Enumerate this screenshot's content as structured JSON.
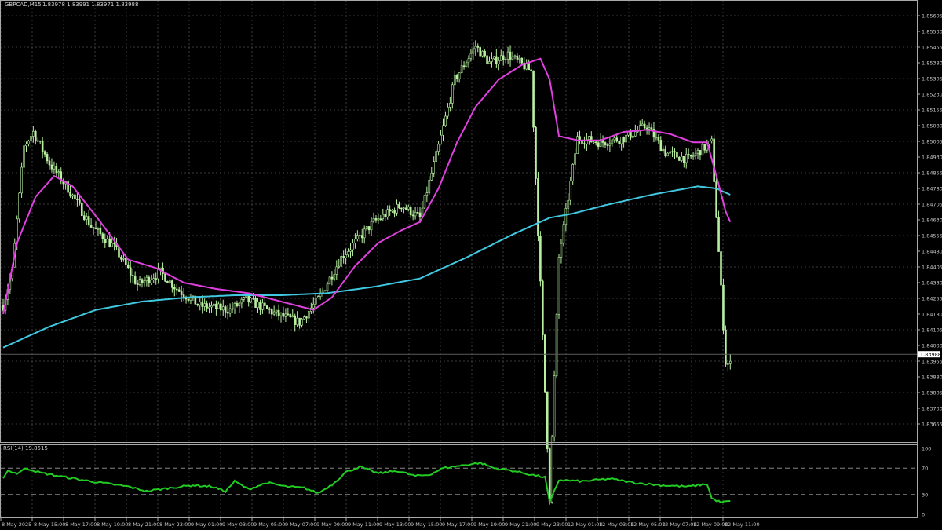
{
  "header": {
    "symbol": "GBPCAD,M15",
    "ohlc": "1.83978 1.83991 1.83971 1.83988"
  },
  "colors": {
    "background": "#000000",
    "grid": "#3a3a3a",
    "axis_text": "#c8c8c8",
    "candle": "#b8f0a0",
    "ma_fast": "#e040e0",
    "ma_slow": "#40c8e0",
    "rsi": "#22cc22",
    "price_tag_bg": "#ffffff",
    "price_tag_text": "#000000"
  },
  "chart_data": [
    {
      "type": "candlestick",
      "title": "GBPCAD,M15",
      "x_ticks": [
        "8 May 2025",
        "8 May 15:00",
        "8 May 17:00",
        "8 May 19:00",
        "8 May 21:00",
        "8 May 23:00",
        "9 May 01:00",
        "9 May 03:00",
        "9 May 05:00",
        "9 May 07:00",
        "9 May 09:00",
        "9 May 11:00",
        "9 May 13:00",
        "9 May 15:00",
        "9 May 17:00",
        "9 May 19:00",
        "9 May 21:00",
        "9 May 23:00",
        "12 May 01:00",
        "12 May 03:00",
        "12 May 05:00",
        "12 May 07:00",
        "12 May 09:00",
        "12 May 11:00"
      ],
      "y_ticks": [
        "1.85605",
        "1.85530",
        "1.85455",
        "1.85380",
        "1.85305",
        "1.85230",
        "1.85155",
        "1.85080",
        "1.85005",
        "1.84930",
        "1.84855",
        "1.84780",
        "1.84705",
        "1.84630",
        "1.84555",
        "1.84480",
        "1.84405",
        "1.84330",
        "1.84255",
        "1.84180",
        "1.84105",
        "1.84030",
        "1.83955",
        "1.83880",
        "1.83805",
        "1.83730",
        "1.83655"
      ],
      "ylim": [
        1.83655,
        1.8568
      ],
      "current_price": "1.83988",
      "close_anchors": [
        [
          0,
          1.8422
        ],
        [
          4,
          1.8439
        ],
        [
          9,
          1.8498
        ],
        [
          13,
          1.8505
        ],
        [
          20,
          1.849
        ],
        [
          28,
          1.8478
        ],
        [
          38,
          1.846
        ],
        [
          48,
          1.845
        ],
        [
          58,
          1.8432
        ],
        [
          68,
          1.8438
        ],
        [
          75,
          1.843
        ],
        [
          85,
          1.8422
        ],
        [
          98,
          1.842
        ],
        [
          105,
          1.8425
        ],
        [
          118,
          1.8418
        ],
        [
          128,
          1.8414
        ],
        [
          136,
          1.8425
        ],
        [
          146,
          1.8445
        ],
        [
          160,
          1.8462
        ],
        [
          172,
          1.847
        ],
        [
          180,
          1.8464
        ],
        [
          188,
          1.8498
        ],
        [
          195,
          1.853
        ],
        [
          204,
          1.8546
        ],
        [
          210,
          1.8538
        ],
        [
          218,
          1.8542
        ],
        [
          228,
          1.8534
        ],
        [
          236,
          1.833
        ],
        [
          240,
          1.8445
        ],
        [
          248,
          1.8502
        ],
        [
          258,
          1.85
        ],
        [
          268,
          1.8502
        ],
        [
          278,
          1.8508
        ],
        [
          286,
          1.8495
        ],
        [
          296,
          1.8492
        ],
        [
          306,
          1.85
        ],
        [
          312,
          1.8395
        ],
        [
          314,
          1.8394
        ]
      ],
      "series": [
        {
          "name": "MA fast",
          "color": "#e040e0",
          "anchors": [
            [
              0,
              1.8418
            ],
            [
              6,
              1.8452
            ],
            [
              14,
              1.8474
            ],
            [
              22,
              1.8484
            ],
            [
              30,
              1.8479
            ],
            [
              42,
              1.8462
            ],
            [
              54,
              1.8444
            ],
            [
              66,
              1.844
            ],
            [
              78,
              1.8433
            ],
            [
              92,
              1.843
            ],
            [
              106,
              1.8428
            ],
            [
              120,
              1.8424
            ],
            [
              134,
              1.842
            ],
            [
              142,
              1.8426
            ],
            [
              152,
              1.8441
            ],
            [
              162,
              1.8452
            ],
            [
              172,
              1.8458
            ],
            [
              180,
              1.8462
            ],
            [
              188,
              1.8478
            ],
            [
              196,
              1.85
            ],
            [
              204,
              1.8517
            ],
            [
              214,
              1.853
            ],
            [
              224,
              1.8537
            ],
            [
              232,
              1.854
            ],
            [
              236,
              1.853
            ],
            [
              240,
              1.8503
            ],
            [
              248,
              1.8501
            ],
            [
              258,
              1.8501
            ],
            [
              268,
              1.8505
            ],
            [
              278,
              1.8506
            ],
            [
              288,
              1.8504
            ],
            [
              298,
              1.85
            ],
            [
              304,
              1.85
            ],
            [
              308,
              1.8484
            ],
            [
              312,
              1.8467
            ],
            [
              314,
              1.8462
            ]
          ]
        },
        {
          "name": "MA slow",
          "color": "#40c8e0",
          "anchors": [
            [
              0,
              1.8402
            ],
            [
              20,
              1.8412
            ],
            [
              40,
              1.842
            ],
            [
              60,
              1.8424
            ],
            [
              80,
              1.8426
            ],
            [
              100,
              1.8427
            ],
            [
              120,
              1.8427
            ],
            [
              140,
              1.8428
            ],
            [
              160,
              1.8431
            ],
            [
              180,
              1.8435
            ],
            [
              200,
              1.8445
            ],
            [
              220,
              1.8456
            ],
            [
              236,
              1.8464
            ],
            [
              246,
              1.8466
            ],
            [
              260,
              1.847
            ],
            [
              280,
              1.8475
            ],
            [
              300,
              1.8479
            ],
            [
              308,
              1.8478
            ],
            [
              314,
              1.8475
            ]
          ]
        }
      ]
    },
    {
      "type": "line",
      "title": "RSI(14) 19.8515",
      "ylim": [
        0,
        100
      ],
      "y_ticks": [
        "100",
        "70",
        "30",
        "0"
      ],
      "levels": [
        70,
        30
      ],
      "series": [
        {
          "name": "RSI(14)",
          "color": "#22cc22",
          "anchors": [
            [
              0,
              56
            ],
            [
              2,
              66
            ],
            [
              6,
              62
            ],
            [
              10,
              70
            ],
            [
              16,
              63
            ],
            [
              24,
              58
            ],
            [
              34,
              52
            ],
            [
              44,
              47
            ],
            [
              54,
              42
            ],
            [
              62,
              35
            ],
            [
              72,
              40
            ],
            [
              82,
              44
            ],
            [
              90,
              42
            ],
            [
              96,
              35
            ],
            [
              100,
              50
            ],
            [
              106,
              38
            ],
            [
              114,
              48
            ],
            [
              122,
              42
            ],
            [
              130,
              40
            ],
            [
              136,
              32
            ],
            [
              142,
              45
            ],
            [
              148,
              64
            ],
            [
              154,
              72
            ],
            [
              162,
              62
            ],
            [
              170,
              66
            ],
            [
              178,
              58
            ],
            [
              184,
              60
            ],
            [
              190,
              70
            ],
            [
              198,
              74
            ],
            [
              206,
              78
            ],
            [
              212,
              70
            ],
            [
              220,
              66
            ],
            [
              228,
              60
            ],
            [
              234,
              56
            ],
            [
              236,
              18
            ],
            [
              240,
              52
            ],
            [
              250,
              50
            ],
            [
              262,
              54
            ],
            [
              272,
              48
            ],
            [
              284,
              44
            ],
            [
              296,
              42
            ],
            [
              304,
              46
            ],
            [
              306,
              24
            ],
            [
              310,
              18
            ],
            [
              314,
              20
            ]
          ]
        }
      ]
    }
  ]
}
